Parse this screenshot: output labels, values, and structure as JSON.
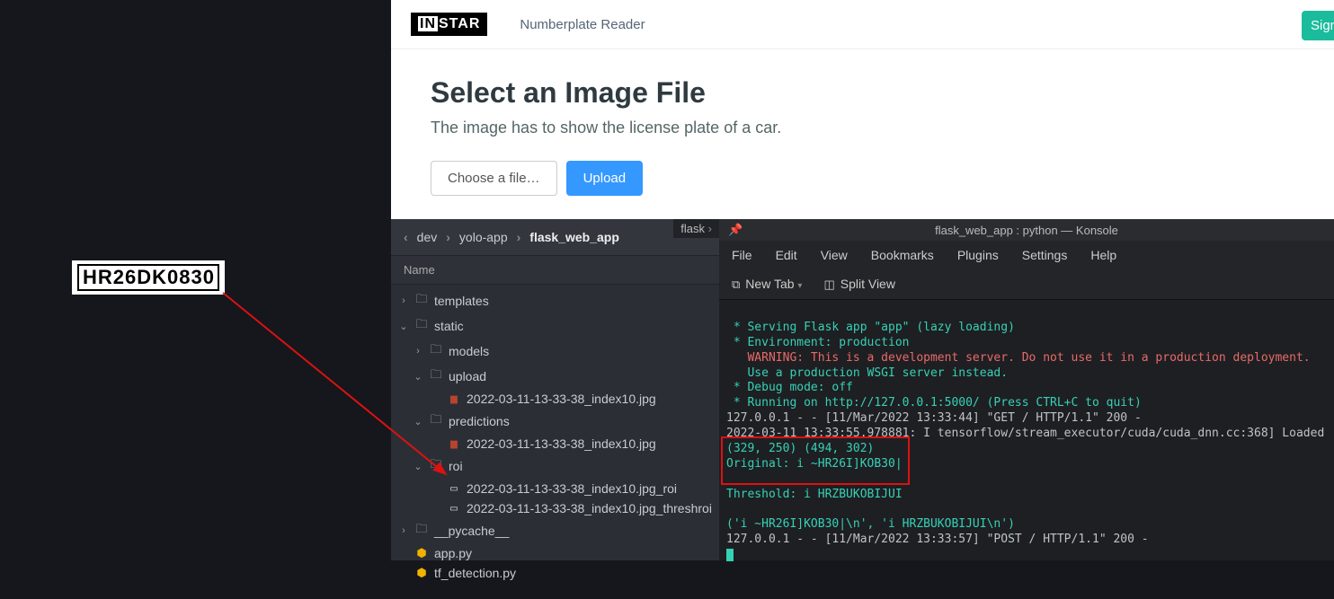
{
  "plate_text": "HR26DK0830",
  "web": {
    "logo_in": "IN",
    "logo_rest": "STAR",
    "nav1": "Numberplate Reader",
    "signup": "Sign Up",
    "h1": "Select an Image File",
    "sub": "The image has to show the license plate of a car.",
    "choose": "Choose a file…",
    "upload": "Upload"
  },
  "explorer": {
    "tab": "flask",
    "bc1": "dev",
    "bc2": "yolo-app",
    "bc3": "flask_web_app",
    "col_name": "Name",
    "nodes": {
      "templates": "templates",
      "static": "static",
      "models": "models",
      "upload": "upload",
      "upload_file": "2022-03-11-13-33-38_index10.jpg",
      "predictions": "predictions",
      "pred_file": "2022-03-11-13-33-38_index10.jpg",
      "roi": "roi",
      "roi_file1": "2022-03-11-13-33-38_index10.jpg_roi",
      "roi_file2": "2022-03-11-13-33-38_index10.jpg_threshroi",
      "pycache": "__pycache__",
      "apppy": "app.py",
      "tfdet": "tf_detection.py"
    }
  },
  "konsole": {
    "pin_icon": "📌",
    "title": "flask_web_app : python — Konsole",
    "menu": {
      "file": "File",
      "edit": "Edit",
      "view": "View",
      "bookmarks": "Bookmarks",
      "plugins": "Plugins",
      "settings": "Settings",
      "help": "Help"
    },
    "tb_newtab": "New Tab",
    "tb_split": "Split View",
    "lines": {
      "l1": " * Serving Flask app \"app\" (lazy loading)",
      "l2": " * Environment: production",
      "l3": "   WARNING: This is a development server. Do not use it in a production deployment.",
      "l4": "   Use a production WSGI server instead.",
      "l5": " * Debug mode: off",
      "l6": " * Running on http://127.0.0.1:5000/ (Press CTRL+C to quit)",
      "l7": "127.0.0.1 - - [11/Mar/2022 13:33:44] \"GET / HTTP/1.1\" 200 -",
      "l8": "2022-03-11 13:33:55.978881: I tensorflow/stream_executor/cuda/cuda_dnn.cc:368] Loaded",
      "l9": "(329, 250) (494, 302)",
      "l10": "Original: i ~HR26I]KOB30|",
      "l11": "Threshold: i HRZBUKOBIJUI",
      "l12": "('i ~HR26I]KOB30|\\n', 'i HRZBUKOBIJUI\\n')",
      "l13": "127.0.0.1 - - [11/Mar/2022 13:33:57] \"POST / HTTP/1.1\" 200 -"
    }
  }
}
